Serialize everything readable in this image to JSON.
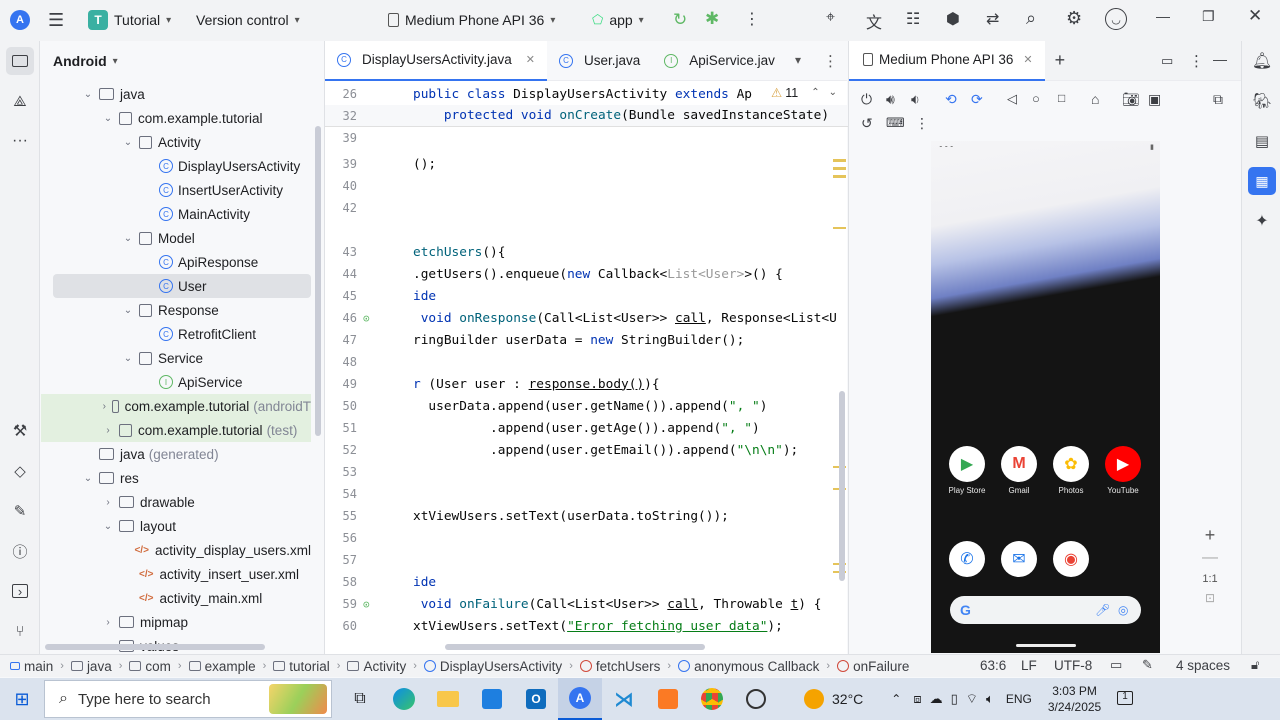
{
  "titlebar": {
    "project_badge": "T",
    "project_name": "Tutorial",
    "vcs": "Version control",
    "device": "Medium Phone API 36",
    "run_config": "app"
  },
  "project_panel": {
    "title": "Android",
    "tree": [
      {
        "label": "java",
        "hint": "",
        "kind": "folder",
        "arrow": "down",
        "indent": 0
      },
      {
        "label": "com.example.tutorial",
        "hint": "",
        "kind": "pkg",
        "arrow": "down",
        "indent": 1
      },
      {
        "label": "Activity",
        "hint": "",
        "kind": "pkg",
        "arrow": "down",
        "indent": 2
      },
      {
        "label": "DisplayUsersActivity",
        "hint": "",
        "kind": "class",
        "arrow": "",
        "indent": 3
      },
      {
        "label": "InsertUserActivity",
        "hint": "",
        "kind": "class",
        "arrow": "",
        "indent": 3
      },
      {
        "label": "MainActivity",
        "hint": "",
        "kind": "class",
        "arrow": "",
        "indent": 3
      },
      {
        "label": "Model",
        "hint": "",
        "kind": "pkg",
        "arrow": "down",
        "indent": 2
      },
      {
        "label": "ApiResponse",
        "hint": "",
        "kind": "class",
        "arrow": "",
        "indent": 3
      },
      {
        "label": "User",
        "hint": "",
        "kind": "class",
        "arrow": "",
        "indent": 3,
        "selected": true
      },
      {
        "label": "Response",
        "hint": "",
        "kind": "pkg",
        "arrow": "down",
        "indent": 2
      },
      {
        "label": "RetrofitClient",
        "hint": "",
        "kind": "class",
        "arrow": "",
        "indent": 3
      },
      {
        "label": "Service",
        "hint": "",
        "kind": "pkg",
        "arrow": "down",
        "indent": 2
      },
      {
        "label": "ApiService",
        "hint": "",
        "kind": "iface",
        "arrow": "",
        "indent": 3
      },
      {
        "label": "com.example.tutorial",
        "hint": "(androidT",
        "kind": "pkg",
        "arrow": "right",
        "indent": 1,
        "green": true
      },
      {
        "label": "com.example.tutorial",
        "hint": "(test)",
        "kind": "pkg",
        "arrow": "right",
        "indent": 1,
        "green": true
      },
      {
        "label": "java",
        "hint": "(generated)",
        "kind": "folder",
        "arrow": "",
        "indent": 0
      },
      {
        "label": "res",
        "hint": "",
        "kind": "folder",
        "arrow": "down",
        "indent": 0
      },
      {
        "label": "drawable",
        "hint": "",
        "kind": "folder",
        "arrow": "right",
        "indent": 1
      },
      {
        "label": "layout",
        "hint": "",
        "kind": "folder",
        "arrow": "down",
        "indent": 1
      },
      {
        "label": "activity_display_users.xml",
        "hint": "",
        "kind": "xml",
        "arrow": "",
        "indent": 2
      },
      {
        "label": "activity_insert_user.xml",
        "hint": "",
        "kind": "xml",
        "arrow": "",
        "indent": 2
      },
      {
        "label": "activity_main.xml",
        "hint": "",
        "kind": "xml",
        "arrow": "",
        "indent": 2
      },
      {
        "label": "mipmap",
        "hint": "",
        "kind": "folder",
        "arrow": "right",
        "indent": 1
      },
      {
        "label": "values",
        "hint": "",
        "kind": "folder",
        "arrow": "down",
        "indent": 1
      }
    ]
  },
  "editor": {
    "tabs": [
      {
        "label": "DisplayUsersActivity.java",
        "active": true,
        "closable": true
      },
      {
        "label": "User.java",
        "active": false,
        "closable": false
      },
      {
        "label": "ApiService.jav",
        "active": false,
        "closable": false
      }
    ],
    "warning_count": "11",
    "lines": [
      {
        "n": "26",
        "html": "<span class='kw'>public class</span> DisplayUsersActivity <span class='kw'>extends</span> Ap"
      },
      {
        "n": "32",
        "html": "    <span class='kw'>protected void</span> <span class='fn'>onCreate</span>(Bundle savedInstanceState)"
      },
      {
        "n": "39",
        "html": ""
      },
      {
        "n": "39",
        "html": "();"
      },
      {
        "n": "40",
        "html": ""
      },
      {
        "n": "42",
        "html": ""
      },
      {
        "n": "",
        "html": ""
      },
      {
        "n": "43",
        "html": "<span class='fn'>etchUsers</span>(){"
      },
      {
        "n": "44",
        "html": ".getUsers().enqueue(<span class='kw'>new</span> Callback&lt;<span class='mut'>List&lt;User&gt;</span>&gt;() {"
      },
      {
        "n": "45",
        "html": "<span class='kw'>ide</span>"
      },
      {
        "n": "46",
        "html": " <span class='kw'>void</span> <span class='fn'>onResponse</span>(Call&lt;List&lt;User&gt;&gt; <span class='ul'>call</span>, Response&lt;List&lt;U"
      },
      {
        "n": "47",
        "html": "ringBuilder userData = <span class='kw'>new</span> StringBuilder();"
      },
      {
        "n": "48",
        "html": ""
      },
      {
        "n": "49",
        "html": "<span class='kw'>r</span> (User user : <span class='ul'>response.body()</span>){"
      },
      {
        "n": "50",
        "html": "  userData.append(user.getName()).append(<span class='str'>\", \"</span>)"
      },
      {
        "n": "51",
        "html": "          .append(user.getAge()).append(<span class='str'>\", \"</span>)"
      },
      {
        "n": "52",
        "html": "          .append(user.getEmail()).append(<span class='str'>\"\\n\\n\"</span>);"
      },
      {
        "n": "53",
        "html": ""
      },
      {
        "n": "54",
        "html": ""
      },
      {
        "n": "55",
        "html": "xtViewUsers.setText(userData.toString());"
      },
      {
        "n": "56",
        "html": ""
      },
      {
        "n": "57",
        "html": ""
      },
      {
        "n": "58",
        "html": "<span class='kw'>ide</span>"
      },
      {
        "n": "59",
        "html": " <span class='kw'>void</span> <span class='fn'>onFailure</span>(Call&lt;List&lt;User&gt;&gt; <span class='ul'>call</span>, Throwable <span class='ul'>t</span>) {"
      },
      {
        "n": "60",
        "html": "xtViewUsers.setText(<span class='str ul'>\"Error fetching user data\"</span>);"
      }
    ]
  },
  "emulator": {
    "tab": "Medium Phone API 36",
    "zoom_ratio": "1:1",
    "apps_row1": [
      {
        "label": "Play Store",
        "glyph": "▶",
        "color": "#34a853"
      },
      {
        "label": "Gmail",
        "glyph": "M",
        "color": "#ea4335"
      },
      {
        "label": "Photos",
        "glyph": "✿",
        "color": "#fbbc04"
      },
      {
        "label": "YouTube",
        "glyph": "▶",
        "color": "#ffffff",
        "bg": "#ff0000"
      }
    ],
    "apps_row2": [
      {
        "glyph": "✆",
        "color": "#1a73e8"
      },
      {
        "glyph": "✉",
        "color": "#1a73e8"
      },
      {
        "glyph": "◉",
        "color": "#ea4335"
      }
    ]
  },
  "breadcrumbs": [
    "main",
    "java",
    "com",
    "example",
    "tutorial",
    "Activity",
    "DisplayUsersActivity",
    "fetchUsers",
    "anonymous Callback",
    "onFailure"
  ],
  "status": {
    "position": "63:6",
    "line_sep": "LF",
    "encoding": "UTF-8",
    "indent": "4 spaces"
  },
  "taskbar": {
    "search_placeholder": "Type here to search",
    "temperature": "32°C",
    "language": "ENG",
    "time": "3:03 PM",
    "date": "3/24/2025",
    "notif_count": "1"
  }
}
